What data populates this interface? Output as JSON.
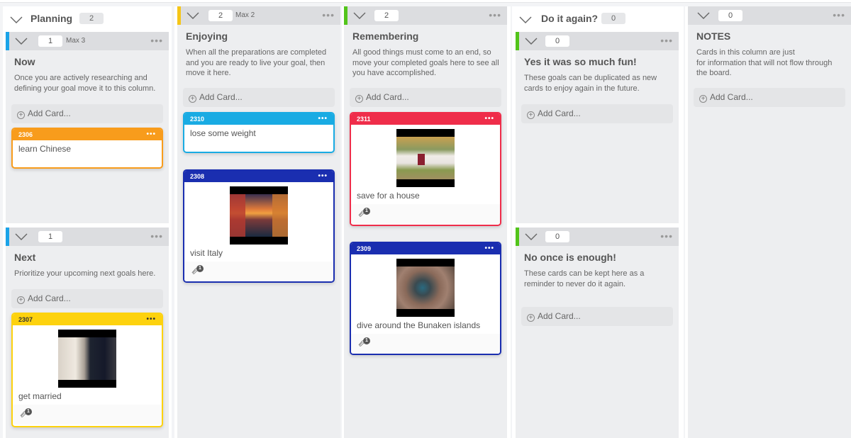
{
  "lanes": {
    "planning": {
      "title": "Planning",
      "count": "2"
    },
    "do_again": {
      "title": "Do it again?",
      "count": "0"
    }
  },
  "columns": {
    "now": {
      "name": "Now",
      "count": "1",
      "max": "Max 3",
      "accent": "#1aa3e8",
      "description": "Once you are actively researching and defining your goal move it to this column."
    },
    "next": {
      "name": "Next",
      "count": "1",
      "accent": "#1aa3e8",
      "description": "Prioritize your upcoming next goals here."
    },
    "enjoying": {
      "name": "Enjoying",
      "count": "2",
      "max": "Max 2",
      "accent": "#f5c518",
      "description": "When all the preparations are completed and you are ready to live your goal, then move it here."
    },
    "remembering": {
      "name": "Remembering",
      "count": "2",
      "accent": "#52c41a",
      "description": "All good things must come to an end, so move your completed goals here to see all you have accomplished."
    },
    "yes_fun": {
      "name": "Yes it was so much fun!",
      "count": "0",
      "accent": "#52c41a",
      "description": "These goals can be duplicated as new cards to enjoy again in the future."
    },
    "no_once": {
      "name": "No once is enough!",
      "count": "0",
      "accent": "#52c41a",
      "description": "These cards can be kept here as a reminder to never do it again."
    },
    "notes": {
      "name": "NOTES",
      "count": "0",
      "description": "Cards in this column are just\nfor information that will not flow through the board."
    }
  },
  "add_card_label": "Add Card...",
  "menu_glyph": "•••",
  "cards": {
    "c2306": {
      "id": "2306",
      "title": "learn Chinese",
      "color": "#f89c1c"
    },
    "c2307": {
      "id": "2307",
      "title": "get married",
      "color": "#fdd20e",
      "attachments": "1",
      "image": "wedding-photo"
    },
    "c2310": {
      "id": "2310",
      "title": "lose some weight",
      "color": "#19abe3"
    },
    "c2308": {
      "id": "2308",
      "title": "visit Italy",
      "color": "#1a2eb0",
      "attachments": "1",
      "image": "italy-canal-photo"
    },
    "c2311": {
      "id": "2311",
      "title": "save for a house",
      "color": "#ef2d4a",
      "attachments": "1",
      "image": "house-photo"
    },
    "c2309": {
      "id": "2309",
      "title": "dive around the Bunaken islands",
      "color": "#1a2eb0",
      "attachments": "1",
      "image": "coral-reef-photo"
    }
  }
}
